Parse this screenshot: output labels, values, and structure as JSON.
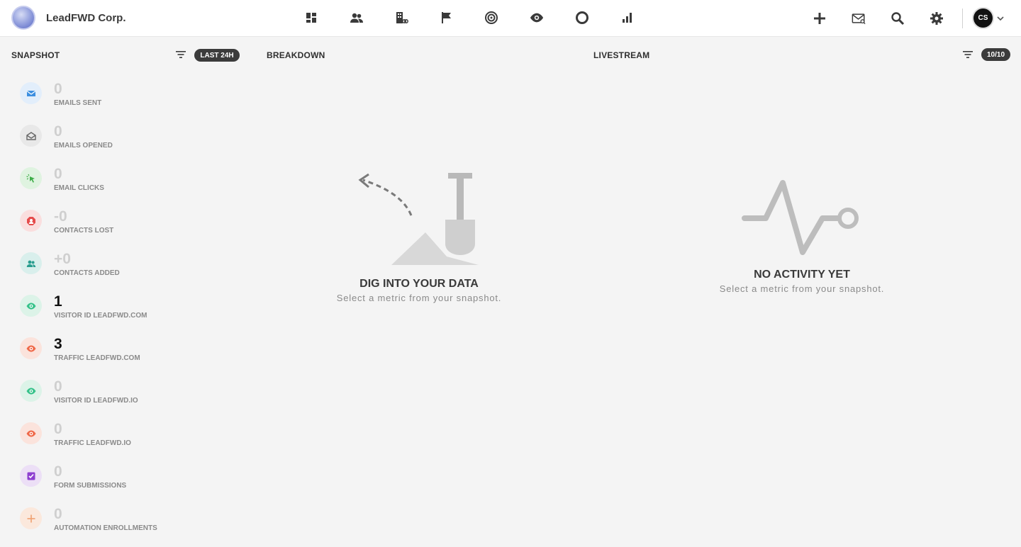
{
  "app": {
    "company_name": "LeadFWD Corp.",
    "user_initials": "CS"
  },
  "nav_icons": [
    "dashboard-icon",
    "contacts-icon",
    "companies-icon",
    "campaigns-flag-icon",
    "target-icon",
    "visitors-eye-icon",
    "circle-icon",
    "reports-bar-icon"
  ],
  "action_icons": [
    "add-icon",
    "email-icon",
    "search-icon",
    "settings-gear-icon"
  ],
  "snapshot": {
    "title": "SNAPSHOT",
    "range_label": "LAST 24H",
    "items": [
      {
        "value": "0",
        "label": "EMAILS SENT",
        "icon": "email-icon",
        "color": "#3d8fe0",
        "bg": "#e2eefb",
        "active": false
      },
      {
        "value": "0",
        "label": "EMAILS OPENED",
        "icon": "email-open-icon",
        "color": "#666666",
        "bg": "#e8e8e8",
        "active": false
      },
      {
        "value": "0",
        "label": "EMAIL CLICKS",
        "icon": "cursor-click-icon",
        "color": "#3fae49",
        "bg": "#dff3e0",
        "active": false
      },
      {
        "value": "-0",
        "label": "CONTACTS LOST",
        "icon": "contact-lost-icon",
        "color": "#e54b4b",
        "bg": "#fadede",
        "active": false
      },
      {
        "value": "+0",
        "label": "CONTACTS ADDED",
        "icon": "contacts-icon",
        "color": "#2a9d8f",
        "bg": "#d9efec",
        "active": false
      },
      {
        "value": "1",
        "label": "VISITOR ID LEADFWD.COM",
        "icon": "eye-icon",
        "color": "#36c28a",
        "bg": "#dcf3e8",
        "active": true
      },
      {
        "value": "3",
        "label": "TRAFFIC LEADFWD.COM",
        "icon": "eye-icon",
        "color": "#ef6a4a",
        "bg": "#fbe3dc",
        "active": true
      },
      {
        "value": "0",
        "label": "VISITOR ID LEADFWD.IO",
        "icon": "eye-icon",
        "color": "#36c28a",
        "bg": "#dcf3e8",
        "active": false
      },
      {
        "value": "0",
        "label": "TRAFFIC LEADFWD.IO",
        "icon": "eye-icon",
        "color": "#ef6a4a",
        "bg": "#fbe3dc",
        "active": false
      },
      {
        "value": "0",
        "label": "FORM SUBMISSIONS",
        "icon": "checkbox-icon",
        "color": "#8e3fd0",
        "bg": "#ecdff6",
        "active": false
      },
      {
        "value": "0",
        "label": "AUTOMATION ENROLLMENTS",
        "icon": "plus-icon",
        "color": "#f0a070",
        "bg": "#fbe8dc",
        "active": false
      }
    ]
  },
  "breakdown": {
    "title": "BREAKDOWN",
    "empty_title": "DIG INTO YOUR DATA",
    "empty_subtitle": "Select a metric from your snapshot."
  },
  "livestream": {
    "title": "LIVESTREAM",
    "count_label": "10/10",
    "empty_title": "NO ACTIVITY YET",
    "empty_subtitle": "Select a metric from your snapshot."
  }
}
